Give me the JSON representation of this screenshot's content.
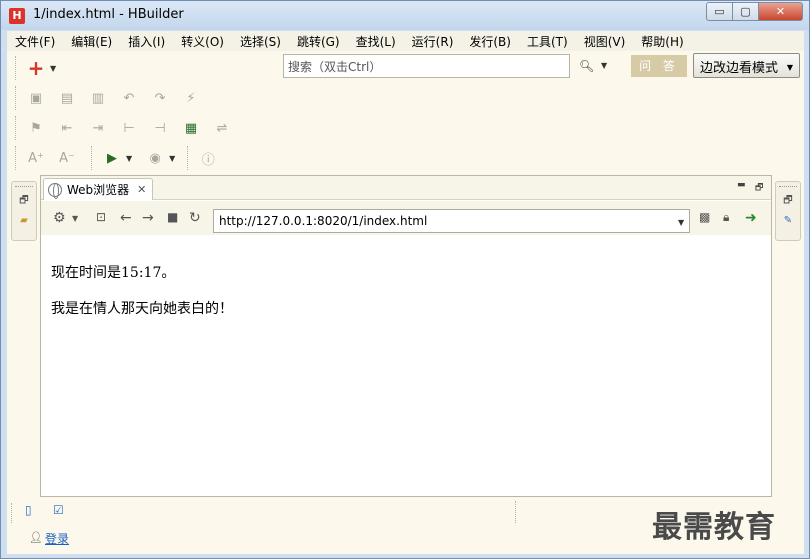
{
  "window": {
    "title": "1/index.html  -  HBuilder",
    "logo_letter": "H",
    "min_symbol": "▭",
    "max_symbol": "▢",
    "close_symbol": "✕"
  },
  "menu": {
    "items": [
      {
        "label": "文件(F)"
      },
      {
        "label": "编辑(E)"
      },
      {
        "label": "插入(I)"
      },
      {
        "label": "转义(O)"
      },
      {
        "label": "选择(S)"
      },
      {
        "label": "跳转(G)"
      },
      {
        "label": "查找(L)"
      },
      {
        "label": "运行(R)"
      },
      {
        "label": "发行(B)"
      },
      {
        "label": "工具(T)"
      },
      {
        "label": "视图(V)"
      },
      {
        "label": "帮助(H)"
      }
    ]
  },
  "toolbar": {
    "add_symbol": "+",
    "search_placeholder": "搜索（双击Ctrl）",
    "qa_label": "问 答",
    "mode_label": "边改边看模式"
  },
  "browser": {
    "tab_label": "Web浏览器",
    "url": "http://127.0.0.1:8020/1/index.html",
    "lines": [
      "现在时间是15:17。",
      "我是在情人那天向她表白的！"
    ]
  },
  "footer": {
    "login_label": "登录"
  },
  "watermark": "最需教育",
  "colors": {
    "accent_red": "#d9332b",
    "link_blue": "#1d5fbf",
    "qa_bg": "#d7cba6"
  }
}
